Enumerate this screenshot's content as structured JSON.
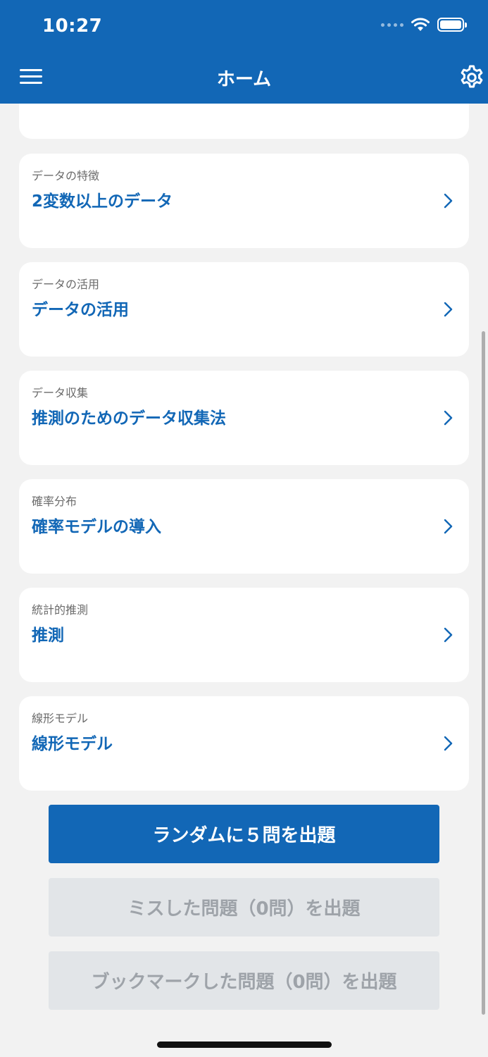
{
  "status_bar": {
    "time": "10:27"
  },
  "nav": {
    "title": "ホーム"
  },
  "cards": [
    {
      "subtitle": "データの特徴",
      "title": "2変数以上のデータ"
    },
    {
      "subtitle": "データの活用",
      "title": "データの活用"
    },
    {
      "subtitle": "データ収集",
      "title": "推測のためのデータ収集法"
    },
    {
      "subtitle": "確率分布",
      "title": "確率モデルの導入"
    },
    {
      "subtitle": "統計的推測",
      "title": "推測"
    },
    {
      "subtitle": "線形モデル",
      "title": "線形モデル"
    }
  ],
  "buttons": {
    "random": "ランダムに５問を出題",
    "missed": "ミスした問題（0問）を出題",
    "bookmarked": "ブックマークした問題（0問）を出題"
  },
  "colors": {
    "primary": "#1267b6",
    "background": "#f2f2f2",
    "disabled_bg": "#e2e5e8",
    "disabled_text": "#9ea3a9"
  },
  "icons": {
    "menu": "hamburger-menu-icon",
    "settings": "gear-icon",
    "chevron": "chevron-right-icon",
    "wifi": "wifi-icon",
    "battery": "battery-icon"
  }
}
